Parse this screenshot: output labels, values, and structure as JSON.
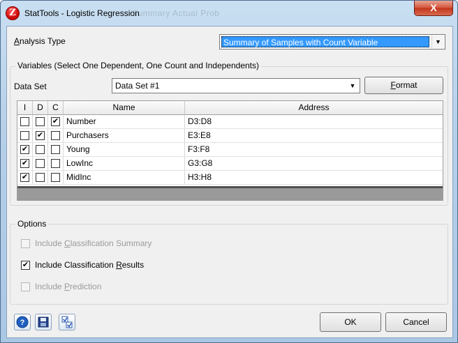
{
  "window": {
    "title": "StatTools - Logistic Regression",
    "ghost_title": "Summary   Actual Prob",
    "app_icon_glyph": "Z",
    "close_glyph": "X"
  },
  "analysis": {
    "label_u": "A",
    "label_rest": "nalysis Type",
    "selected": "Summary of Samples with Count Variable",
    "arrow": "▼"
  },
  "variables": {
    "group_title": "Variables (Select One Dependent, One Count and Independents)",
    "dataset_label": "Data Set",
    "dataset_value": "Data Set #1",
    "dataset_arrow": "▼",
    "format_button_u": "F",
    "format_button_rest": "ormat",
    "columns": {
      "i": "I",
      "d": "D",
      "c": "C",
      "name": "Name",
      "address": "Address"
    },
    "rows": [
      {
        "i": "",
        "d": "",
        "c": "✔",
        "name": "Number",
        "address": "D3:D8"
      },
      {
        "i": "",
        "d": "✔",
        "c": "",
        "name": "Purchasers",
        "address": "E3:E8"
      },
      {
        "i": "✔",
        "d": "",
        "c": "",
        "name": "Young",
        "address": "F3:F8"
      },
      {
        "i": "✔",
        "d": "",
        "c": "",
        "name": "LowInc",
        "address": "G3:G8"
      },
      {
        "i": "✔",
        "d": "",
        "c": "",
        "name": "MidInc",
        "address": "H3:H8"
      }
    ]
  },
  "options": {
    "group_title": "Options",
    "items": [
      {
        "u_pre": "Include ",
        "u": "C",
        "u_post": "lassification Summary",
        "checked": "",
        "enabled": false
      },
      {
        "u_pre": "Include Classification ",
        "u": "R",
        "u_post": "esults",
        "checked": "✔",
        "enabled": true
      },
      {
        "u_pre": "Include ",
        "u": "P",
        "u_post": "rediction",
        "checked": "",
        "enabled": false
      }
    ]
  },
  "footer": {
    "ok": "OK",
    "cancel": "Cancel",
    "help_glyph": "?",
    "colors": {
      "accent": "#3399ff",
      "close": "#c2341a",
      "help_blue": "#1f5fbf"
    }
  }
}
